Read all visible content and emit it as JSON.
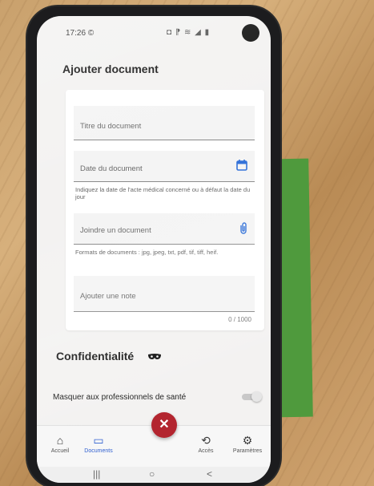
{
  "status_bar": {
    "time": "17:26",
    "whatsapp_glyph": "©",
    "icons_text": "◘ ⁋ ≋ ◢ ▮"
  },
  "header": {
    "title": "Ajouter document"
  },
  "form": {
    "title_field": {
      "placeholder": "Titre du document"
    },
    "date_field": {
      "placeholder": "Date du document",
      "icon": "calendar-icon",
      "helper": "Indiquez la date de l'acte médical concerné ou à défaut la date du jour"
    },
    "attach_field": {
      "placeholder": "Joindre un document",
      "icon": "paperclip-icon",
      "helper": "Formats de documents : jpg, jpeg, txt, pdf, tif, tiff, heif."
    },
    "note_field": {
      "placeholder": "Ajouter une note",
      "counter": "0 / 1000"
    }
  },
  "privacy": {
    "title": "Confidentialité",
    "icon": "mask-icon",
    "toggle_label": "Masquer aux professionnels de santé",
    "toggle_on": false
  },
  "bottom_nav": {
    "items": [
      {
        "label": "Accueil",
        "icon": "home-icon",
        "glyph": "⌂",
        "active": false
      },
      {
        "label": "Documents",
        "icon": "folder-icon",
        "glyph": "▭",
        "active": true
      },
      {
        "label": "Accès",
        "icon": "history-icon",
        "glyph": "⟲",
        "active": false
      },
      {
        "label": "Paramètres",
        "icon": "gear-icon",
        "glyph": "⚙",
        "active": false
      }
    ],
    "fab_icon": "close-icon",
    "fab_glyph": "✕"
  },
  "system_nav": {
    "recents_glyph": "|||",
    "home_glyph": "○",
    "back_glyph": "<"
  },
  "colors": {
    "accent_blue": "#2f5fd0",
    "fab_red": "#b3252f",
    "background": "#f3f2f1"
  }
}
